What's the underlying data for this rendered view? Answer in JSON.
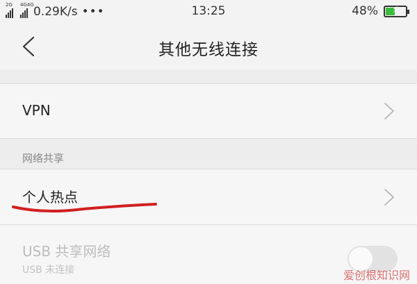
{
  "status": {
    "net_left": "2G",
    "net_right": "4G4G",
    "speed": "0.29K/s",
    "more": "•••",
    "time": "13:25",
    "battery": "48%",
    "battery_level": 0.48
  },
  "header": {
    "title": "其他无线连接"
  },
  "vpn": {
    "label": "VPN"
  },
  "tethering": {
    "section_title": "网络共享",
    "hotspot_label": "个人热点",
    "usb_label": "USB 共享网络",
    "usb_status": "USB 未连接",
    "usb_enabled": false
  },
  "watermark": "爱创根知识网",
  "colors": {
    "battery_fill": "#3dbb3d",
    "annotation": "#d21f1f"
  }
}
